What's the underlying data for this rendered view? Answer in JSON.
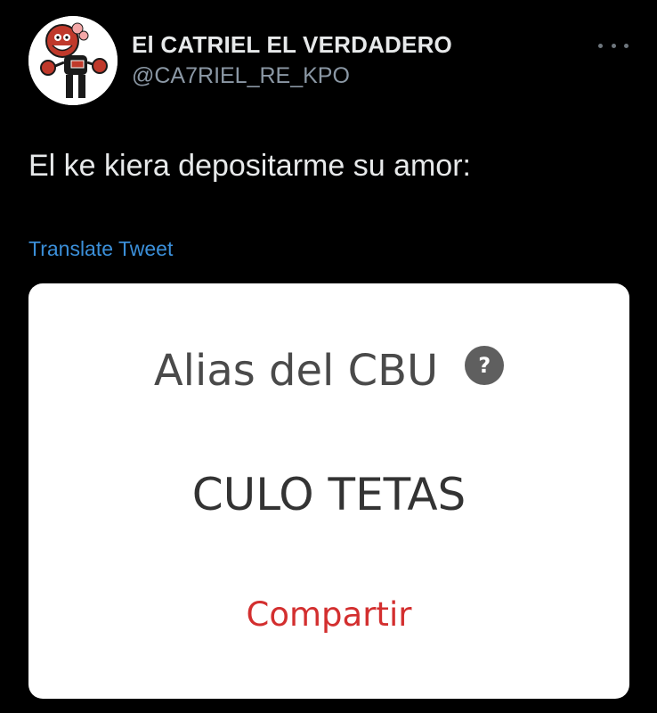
{
  "tweet": {
    "author": {
      "display_name": "El CATRIEL EL VERDADERO",
      "handle": "@CA7RIEL_RE_KPO",
      "avatar_icon": "cartoon-character-avatar"
    },
    "more_icon": "more-options-icon",
    "text": "El ke kiera depositarme su amor:",
    "translate_label": "Translate Tweet"
  },
  "media": {
    "alias_label": "Alias del CBU",
    "help_icon": "?",
    "alias_value": "CULO TETAS",
    "share_label": "Compartir"
  },
  "colors": {
    "background": "#000000",
    "link": "#3b8fd9",
    "share": "#d32f2f"
  }
}
